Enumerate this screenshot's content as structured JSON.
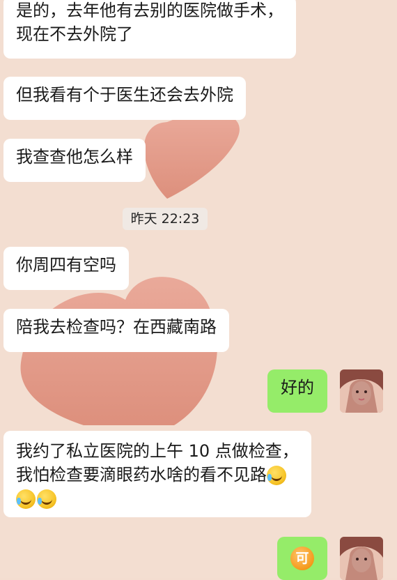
{
  "messages": [
    {
      "side": "left",
      "lines": [
        "是的，去年他有去别的医院做手术，",
        "现在不去外院了"
      ]
    },
    {
      "side": "left",
      "lines": [
        "但我看有个于医生还会去外院"
      ]
    },
    {
      "side": "left",
      "lines": [
        "我查查他怎么样"
      ]
    },
    {
      "side": "left",
      "lines": [
        "你周四有空吗"
      ]
    },
    {
      "side": "left",
      "lines": [
        "陪我去检查吗？在西藏南路"
      ]
    },
    {
      "side": "right",
      "lines": [
        "好的"
      ]
    },
    {
      "side": "left",
      "lines": [
        "我约了私立医院的上午 10 点做检查，",
        "我怕检查要滴眼药水啥的看不见路"
      ]
    },
    {
      "side": "right",
      "lines": [
        "可"
      ]
    }
  ],
  "timestamp": "昨天 22:23",
  "emoji_name": "laughing-crying-emoji",
  "colors": {
    "incoming": "#ffffff",
    "outgoing": "#95ec69",
    "background": "#f3ddd0",
    "heart": "#e59a86"
  }
}
